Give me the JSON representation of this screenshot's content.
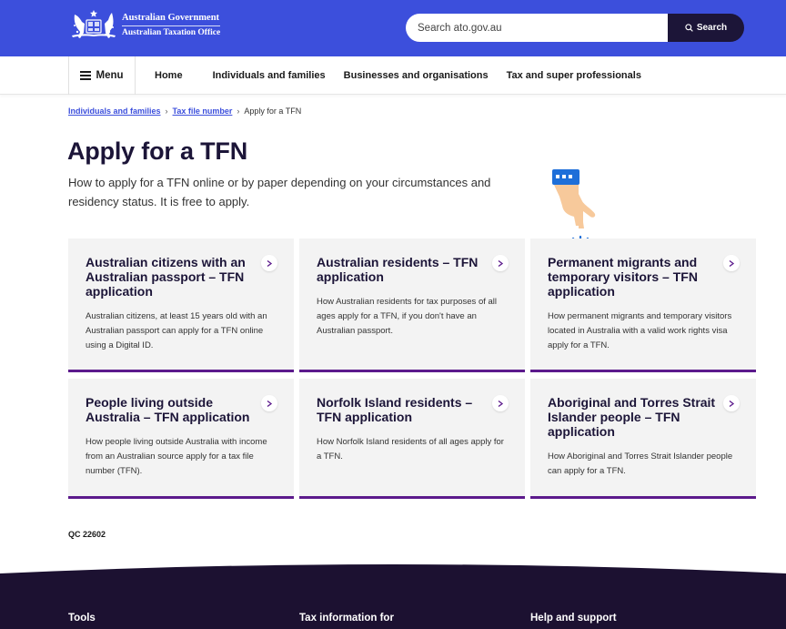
{
  "header": {
    "gov_name": "Australian Government",
    "agency_name": "Australian Taxation Office",
    "search_placeholder": "Search ato.gov.au",
    "search_button": "Search"
  },
  "nav": {
    "menu_label": "Menu",
    "links": [
      "Home",
      "Individuals and families",
      "Businesses and organisations",
      "Tax and super professionals"
    ]
  },
  "breadcrumb": {
    "items": [
      "Individuals and families",
      "Tax file number"
    ],
    "current": "Apply for a TFN"
  },
  "page": {
    "title": "Apply for a TFN",
    "intro": "How to apply for a TFN online or by paper depending on your circumstances and residency status. It is free to apply."
  },
  "cards": [
    {
      "title": "Australian citizens with an Australian passport – TFN application",
      "desc": "Australian citizens, at least 15 years old with an Australian passport can apply for a TFN online using a Digital ID."
    },
    {
      "title": "Australian residents – TFN application",
      "desc": "How Australian residents for tax purposes of all ages apply for a TFN, if you don't have an Australian passport."
    },
    {
      "title": "Permanent migrants and temporary visitors – TFN application",
      "desc": "How permanent migrants and temporary visitors located in Australia with a valid work rights visa apply for a TFN."
    },
    {
      "title": "People living outside Australia – TFN application",
      "desc": "How people living outside Australia with income from an Australian source apply for a tax file number (TFN)."
    },
    {
      "title": "Norfolk Island residents – TFN application",
      "desc": "How Norfolk Island residents of all ages apply for a TFN."
    },
    {
      "title": "Aboriginal and Torres Strait Islander people – TFN application",
      "desc": "How Aboriginal and Torres Strait Islander people can apply for a TFN."
    }
  ],
  "qc_code": "QC 22602",
  "footer": {
    "columns": [
      "Tools",
      "Tax information for",
      "Help and support"
    ]
  },
  "colors": {
    "header_blue": "#3c4fdc",
    "dark_navy": "#1c1538",
    "card_accent": "#5c1a8c",
    "card_bg": "#f3f3f3"
  }
}
